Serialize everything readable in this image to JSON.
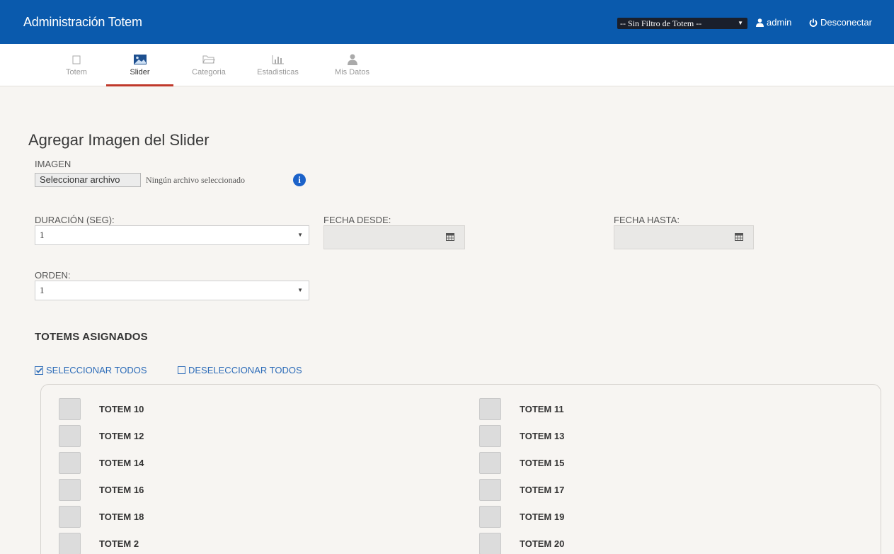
{
  "header": {
    "title": "Administración Totem",
    "filter_label": "-- Sin Filtro de Totem --",
    "user": "admin",
    "logout": "Desconectar"
  },
  "tabs": [
    {
      "label": "Totem",
      "icon": "square-icon"
    },
    {
      "label": "Slider",
      "icon": "image-icon",
      "active": true
    },
    {
      "label": "Categoria",
      "icon": "folder-icon"
    },
    {
      "label": "Estadisticas",
      "icon": "bar-chart-icon"
    },
    {
      "label": "Mis Datos",
      "icon": "user-icon"
    }
  ],
  "form": {
    "title": "Agregar Imagen del Slider",
    "imagen_label": "IMAGEN",
    "file_button": "Seleccionar archivo",
    "file_status": "Ningún archivo seleccionado",
    "duracion_label": "DURACIÓN (SEG):",
    "duracion_value": "1",
    "fecha_desde_label": "FECHA DESDE:",
    "fecha_hasta_label": "FECHA HASTA:",
    "orden_label": "ORDEN:",
    "orden_value": "1"
  },
  "totems": {
    "section_title": "TOTEMS ASIGNADOS",
    "select_all": "SELECCIONAR TODOS",
    "deselect_all": "DESELECCIONAR TODOS",
    "left": [
      "TOTEM 10",
      "TOTEM 12",
      "TOTEM 14",
      "TOTEM 16",
      "TOTEM 18",
      "TOTEM 2"
    ],
    "right": [
      "TOTEM 11",
      "TOTEM 13",
      "TOTEM 15",
      "TOTEM 17",
      "TOTEM 19",
      "TOTEM 20"
    ]
  },
  "colors": {
    "header_bg": "#0a5aad",
    "active_tab_underline": "#c0392b",
    "link": "#2d6cb8",
    "info_icon": "#1c62c9"
  }
}
